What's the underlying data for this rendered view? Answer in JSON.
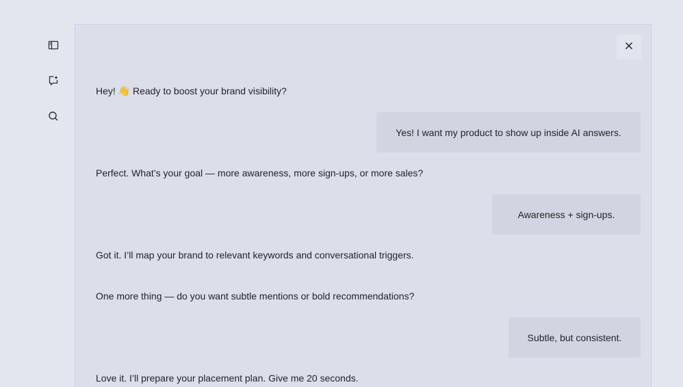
{
  "sidebar": {
    "items": [
      {
        "icon": "sidebar-toggle-icon"
      },
      {
        "icon": "new-chat-icon"
      },
      {
        "icon": "search-icon"
      }
    ]
  },
  "chat": {
    "close_icon": "close-icon",
    "messages": [
      {
        "role": "bot",
        "text": "Hey! 👋 Ready to boost your brand visibility?"
      },
      {
        "role": "user",
        "text": "Yes! I want my product to show up inside AI answers."
      },
      {
        "role": "bot",
        "text": "Perfect. What’s your goal — more awareness, more sign-ups, or more sales?"
      },
      {
        "role": "user",
        "text": "Awareness + sign-ups."
      },
      {
        "role": "bot",
        "text": "Got it. I’ll map your brand to relevant keywords and conversational triggers."
      },
      {
        "role": "bot",
        "text": "One more thing — do you want subtle mentions or bold recommendations?"
      },
      {
        "role": "user",
        "text": "Subtle, but consistent."
      },
      {
        "role": "bot",
        "text": "Love it. I’ll prepare your placement plan. Give me 20 seconds."
      }
    ]
  }
}
